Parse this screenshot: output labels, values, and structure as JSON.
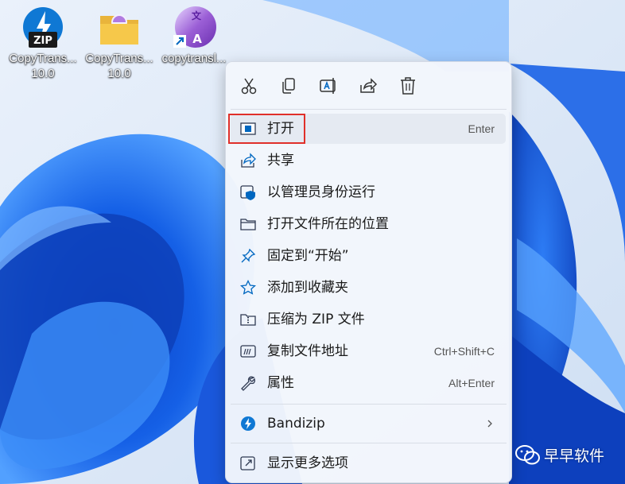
{
  "desktop": {
    "icons": [
      {
        "label_line1": "CopyTrans...",
        "label_line2": "10.0",
        "badge": "ZIP",
        "icon": "bandizip-archive-icon"
      },
      {
        "label_line1": "CopyTrans...",
        "label_line2": "10.0",
        "icon": "folder-icon"
      },
      {
        "label_line1": "copytransl...",
        "label_line2": "",
        "badge_top": "文",
        "badge_bottom": "A",
        "icon": "translator-shortcut-icon"
      }
    ]
  },
  "context_menu": {
    "toolbar": [
      {
        "icon": "cut-icon"
      },
      {
        "icon": "copy-icon"
      },
      {
        "icon": "rename-icon"
      },
      {
        "icon": "share-icon"
      },
      {
        "icon": "delete-icon"
      }
    ],
    "items": [
      {
        "label": "打开",
        "shortcut": "Enter",
        "icon": "open-icon"
      },
      {
        "label": "共享",
        "shortcut": "",
        "icon": "share-icon"
      },
      {
        "label": "以管理员身份运行",
        "shortcut": "",
        "icon": "admin-shield-icon"
      },
      {
        "label": "打开文件所在的位置",
        "shortcut": "",
        "icon": "folder-icon"
      },
      {
        "label": "固定到“开始”",
        "shortcut": "",
        "icon": "pin-icon"
      },
      {
        "label": "添加到收藏夹",
        "shortcut": "",
        "icon": "star-icon"
      },
      {
        "label": "压缩为 ZIP 文件",
        "shortcut": "",
        "icon": "zip-file-icon"
      },
      {
        "label": "复制文件地址",
        "shortcut": "Ctrl+Shift+C",
        "icon": "copy-path-icon"
      },
      {
        "label": "属性",
        "shortcut": "Alt+Enter",
        "icon": "wrench-icon"
      }
    ],
    "bandizip": {
      "label": "Bandizip",
      "icon": "bandizip-icon",
      "arrow": "chevron-right-icon"
    },
    "more_options": {
      "label": "显示更多选项",
      "icon": "more-options-icon"
    }
  },
  "watermark": {
    "text": "早早软件",
    "icon": "wechat-icon"
  },
  "colors": {
    "accent": "#0067c0",
    "highlight_border": "#e0302a",
    "menu_bg": "#f3f6fc"
  }
}
